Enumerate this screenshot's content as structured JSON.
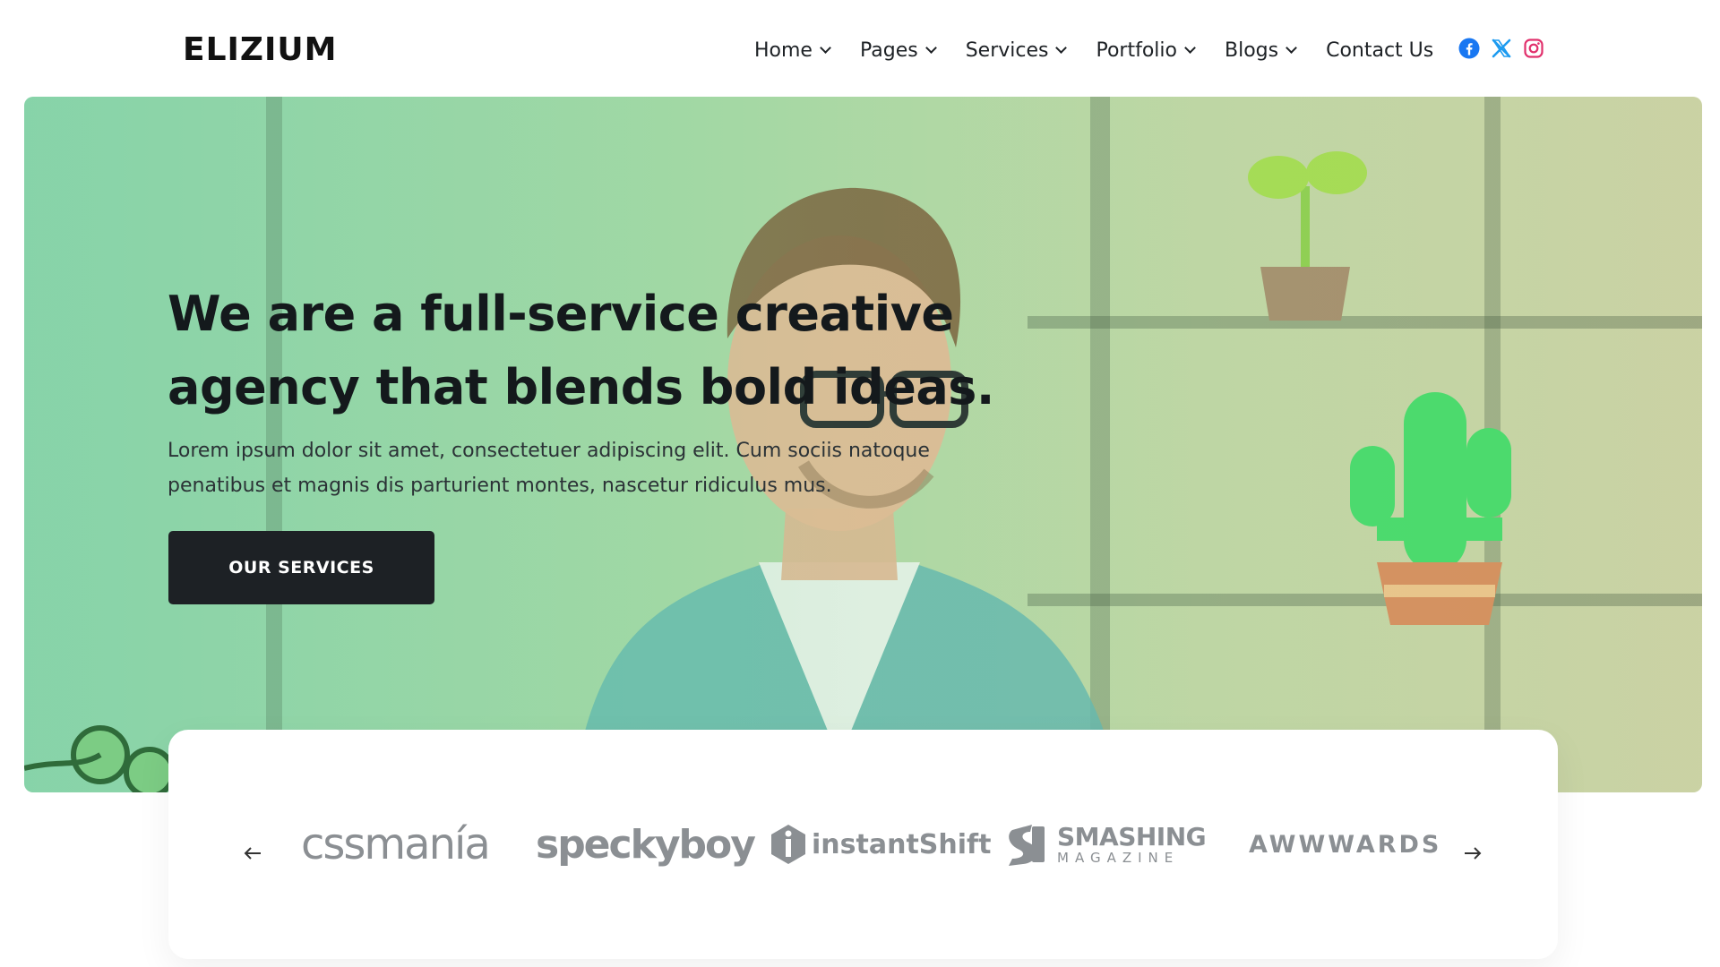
{
  "header": {
    "logo": "ELIZIUM",
    "nav": [
      {
        "label": "Home",
        "has_dropdown": true
      },
      {
        "label": "Pages",
        "has_dropdown": true
      },
      {
        "label": "Services",
        "has_dropdown": true
      },
      {
        "label": "Portfolio",
        "has_dropdown": true
      },
      {
        "label": "Blogs",
        "has_dropdown": true
      },
      {
        "label": "Contact Us",
        "has_dropdown": false
      }
    ],
    "social": [
      {
        "icon": "facebook-icon",
        "color": "#1877f2"
      },
      {
        "icon": "x-twitter-icon",
        "color": "#1d9bf0"
      },
      {
        "icon": "instagram-icon",
        "color": "#e1306c"
      }
    ]
  },
  "hero": {
    "title_line1": "We are a full-service creative",
    "title_line2": "agency that blends bold ideas.",
    "description_line1": "Lorem ipsum dolor sit amet, consectetuer adipiscing elit. Cum sociis natoque",
    "description_line2": "penatibus et magnis dis parturient montes, nascetur ridiculus mus.",
    "cta_label": "OUR SERVICES",
    "overlay_color": "#8fd4ae"
  },
  "brands": {
    "prev_icon": "arrow-left-icon",
    "next_icon": "arrow-right-icon",
    "items": [
      {
        "name": "cssmanía"
      },
      {
        "name": "speckyboy"
      },
      {
        "name": "instantShift"
      },
      {
        "name": "SMASHING",
        "sub": "MAGAZINE"
      },
      {
        "name": "AWWWARDS"
      }
    ],
    "logo_color": "#8b8f93"
  },
  "colors": {
    "dark": "#1d2125",
    "button_text": "#ffffff"
  }
}
